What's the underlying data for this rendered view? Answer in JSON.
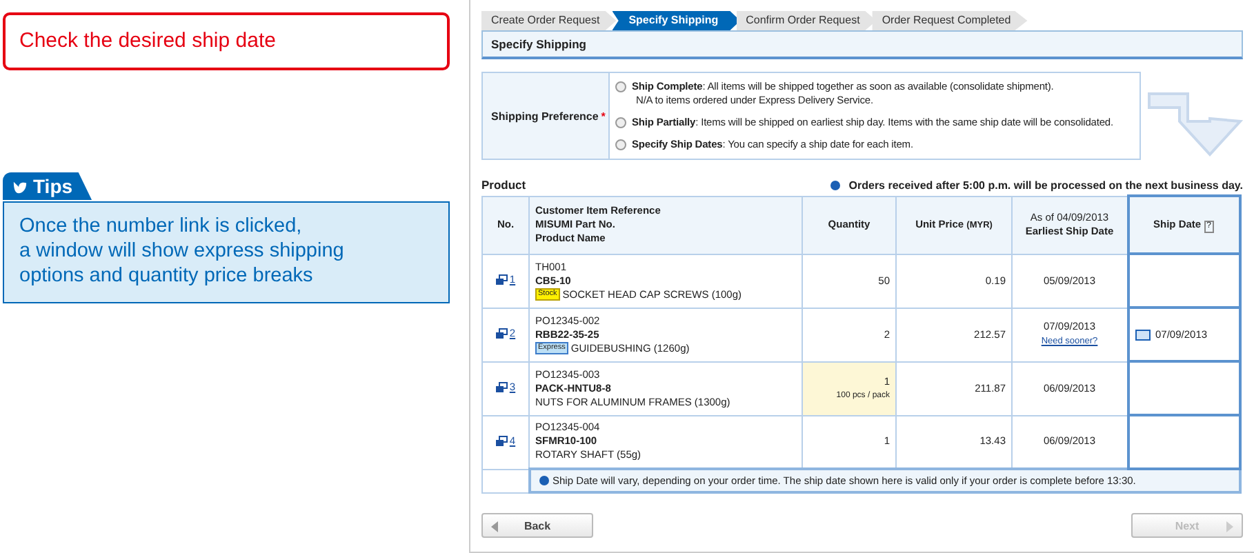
{
  "callout": {
    "text": "Check the desired ship date"
  },
  "tips": {
    "title": "Tips",
    "text": "Once the number link is clicked,\na window will show express shipping\noptions and quantity price breaks"
  },
  "steps": [
    {
      "label": "Create Order Request",
      "selected": false
    },
    {
      "label": "Specify Shipping",
      "selected": true
    },
    {
      "label": "Confirm Order Request",
      "selected": false
    },
    {
      "label": "Order Request Completed",
      "selected": false
    }
  ],
  "section_title": "Specify Shipping",
  "shipping_preference": {
    "label": "Shipping Preference",
    "required_mark": "*",
    "options": [
      {
        "text": "**Ship Complete**: All items will be shipped together as soon as available (consolidate shipment).",
        "subtext": "N/A to items ordered under Express Delivery Service.",
        "selected": false
      },
      {
        "text": "**Ship Partially**: Items will be shipped on earliest ship day. Items with the same ship date will be consolidated.",
        "selected": false
      },
      {
        "text": "**Specify Ship Dates**: You can specify a ship date for each item.",
        "selected": false
      }
    ]
  },
  "product": {
    "label": "Product",
    "notice": "Orders received after 5:00 p.m. will be processed on the next business day."
  },
  "table": {
    "headers": {
      "no": "No.",
      "reference": [
        "Customer Item Reference",
        "MISUMI Part No.",
        "Product Name"
      ],
      "quantity": "Quantity",
      "unit_price": "Unit Price",
      "currency": "(MYR)",
      "as_of": "As of 04/09/2013",
      "earliest": "Earliest Ship Date",
      "ship_date": "Ship Date",
      "help": "?"
    },
    "rows": [
      {
        "no": "1",
        "reference": "TH001",
        "part_no": "CB5-10",
        "badge": {
          "kind": "stock",
          "text": "Stock"
        },
        "product_name": "SOCKET HEAD CAP SCREWS (100g)",
        "quantity": "50",
        "highlighted": false,
        "unit_price": "0.19",
        "earliest_ship_date": "05/09/2013"
      },
      {
        "no": "2",
        "reference": "PO12345-002",
        "part_no": "RBB22-35-25",
        "badge": {
          "kind": "express",
          "text": "Express"
        },
        "product_name": "GUIDEBUSHING (1260g)",
        "quantity": "2",
        "highlighted": false,
        "unit_price": "212.57",
        "earliest_ship_date": "07/09/2013",
        "link": "Need sooner?",
        "ship_date": "07/09/2013"
      },
      {
        "no": "3",
        "reference": "PO12345-003",
        "part_no": "PACK-HNTU8-8",
        "product_name": "NUTS FOR ALUMINUM FRAMES (1300g)",
        "quantity": "1",
        "quantity_note": "100 pcs / pack",
        "highlighted": true,
        "unit_price": "211.87",
        "earliest_ship_date": "06/09/2013"
      },
      {
        "no": "4",
        "reference": "PO12345-004",
        "part_no": "SFMR10-100",
        "product_name": "ROTARY SHAFT (55g)",
        "quantity": "1",
        "highlighted": false,
        "unit_price": "13.43",
        "earliest_ship_date": "06/09/2013"
      }
    ],
    "note": "Ship Date will vary, depending on your order time. The ship date shown here is valid only if your order is complete before 13:30."
  },
  "buttons": [
    {
      "label": "Back",
      "kind": "back",
      "disabled": false
    },
    {
      "label": "Next",
      "kind": "next",
      "disabled": true
    }
  ]
}
